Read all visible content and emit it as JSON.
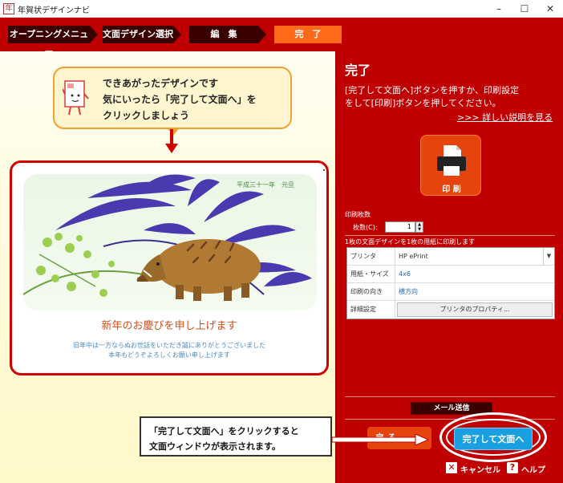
{
  "window": {
    "title": "年賀状デザインナビ",
    "minimize": "–",
    "maximize": "☐",
    "close": "✕"
  },
  "steps": [
    {
      "label": "オープニングメニュー"
    },
    {
      "label": "文面デザイン選択"
    },
    {
      "label": "編　集"
    },
    {
      "label": "完　了"
    }
  ],
  "guide": {
    "line1": "できあがったデザインです",
    "line2": "気にいったら「完了して文面へ」を",
    "line3": "クリックしましょう"
  },
  "card": {
    "date": "平成三十一年　元旦",
    "greeting": "新年のお慶びを申し上げます",
    "message_line1": "旧年中は一方ならぬお世話をいただき誠にありがとうございました",
    "message_line2": "本年もどうぞよろしくお願い申し上げます"
  },
  "panel": {
    "title": "完了",
    "desc_line1": "[完了して文面へ]ボタンを押すか、印刷設定",
    "desc_line2": "をして[印刷]ボタンを押してください。",
    "link": ">>> 詳しい説明を見る",
    "print_label": "印 刷",
    "copies_section": "印刷枚数",
    "copies_label": "枚数(C):",
    "copies_value": "1",
    "copies_info": "1枚の文面デザインを1枚の用紙に印刷します",
    "settings": [
      {
        "label": "プリンタ",
        "value": "HP ePrint"
      },
      {
        "label": "用紙・サイズ",
        "value": "4x6"
      },
      {
        "label": "印刷の向き",
        "value": "横方向"
      }
    ],
    "detail_label": "詳細設定",
    "printer_props": "プリンタのプロパティ...",
    "mail_button": "メール送信",
    "back_button": "戻 る",
    "done_button": "完了して文面へ",
    "cancel_label": "キャンセル",
    "help_label": "ヘルプ"
  },
  "callout": {
    "line1": "「完了して文面へ」をクリックすると",
    "line2": "文面ウィンドウが表示されます。"
  },
  "colors": {
    "brand_red": "#c00000",
    "accent_orange": "#ff6a1a",
    "done_blue": "#1aa0e0"
  }
}
